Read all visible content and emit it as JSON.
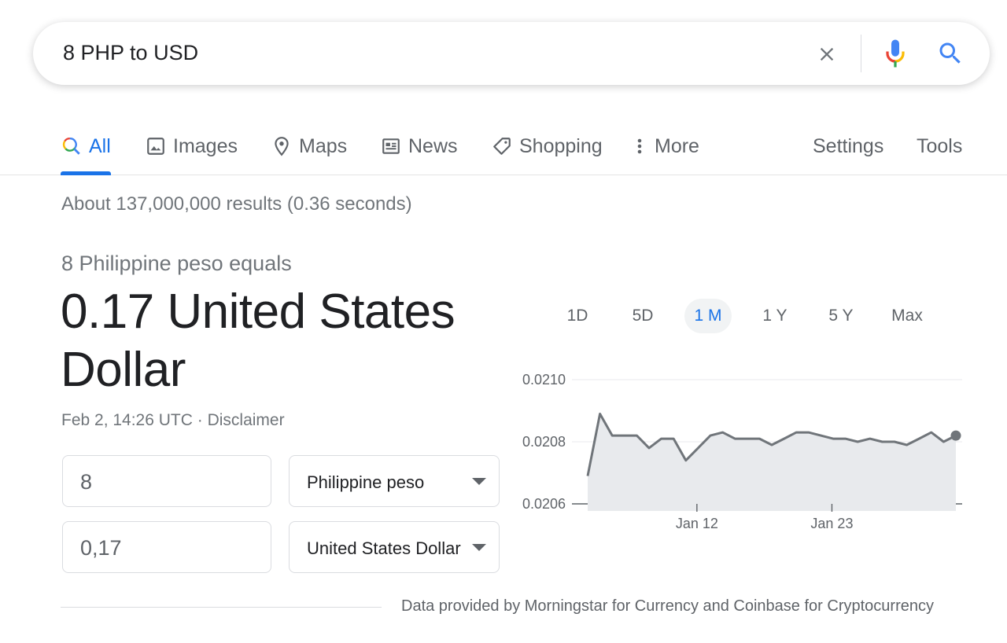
{
  "search": {
    "query": "8 PHP to USD",
    "icons": {
      "clear": "close-icon",
      "mic": "mic-icon",
      "search": "search-icon"
    }
  },
  "tabs": [
    {
      "label": "All",
      "icon": "search-icon",
      "active": true
    },
    {
      "label": "Images",
      "icon": "image-icon"
    },
    {
      "label": "Maps",
      "icon": "map-pin-icon"
    },
    {
      "label": "News",
      "icon": "newspaper-icon"
    },
    {
      "label": "Shopping",
      "icon": "tag-icon"
    },
    {
      "label": "More",
      "icon": "more-vert-icon"
    }
  ],
  "tools": {
    "settings": "Settings",
    "tools": "Tools"
  },
  "results_stats": "About 137,000,000 results (0.36 seconds)",
  "converter": {
    "equals_label": "8 Philippine peso equals",
    "result_line1": "0.17 United States",
    "result_line2": "Dollar",
    "timestamp": "Feb 2, 14:26 UTC · ",
    "disclaimer": "Disclaimer",
    "from_amount": "8",
    "from_currency": "Philippine peso",
    "to_amount": "0,17",
    "to_currency": "United States Dollar"
  },
  "chart_ranges": [
    {
      "label": "1D"
    },
    {
      "label": "5D"
    },
    {
      "label": "1 M",
      "active": true
    },
    {
      "label": "1 Y"
    },
    {
      "label": "5 Y"
    },
    {
      "label": "Max"
    }
  ],
  "chart_data": {
    "type": "area",
    "ylim": [
      0.0206,
      0.021
    ],
    "y_ticks": [
      "0.0210",
      "0.0208",
      "0.0206"
    ],
    "x_ticks": [
      "Jan 12",
      "Jan 23"
    ],
    "x_tick_positions": [
      8.9,
      19.9
    ],
    "values": [
      0.02069,
      0.02089,
      0.02082,
      0.02082,
      0.02082,
      0.02078,
      0.02081,
      0.02081,
      0.02074,
      0.02078,
      0.02082,
      0.02083,
      0.02081,
      0.02081,
      0.02081,
      0.02079,
      0.02081,
      0.02083,
      0.02083,
      0.02082,
      0.02081,
      0.02081,
      0.0208,
      0.02081,
      0.0208,
      0.0208,
      0.02079,
      0.02081,
      0.02083,
      0.0208,
      0.02082
    ],
    "colors": {
      "line": "#70757a",
      "fill": "#e8eaed",
      "axis": "#5f6368",
      "grid": "#e8eaed"
    }
  },
  "attribution": "Data provided by Morningstar for Currency and Coinbase for Cryptocurrency"
}
